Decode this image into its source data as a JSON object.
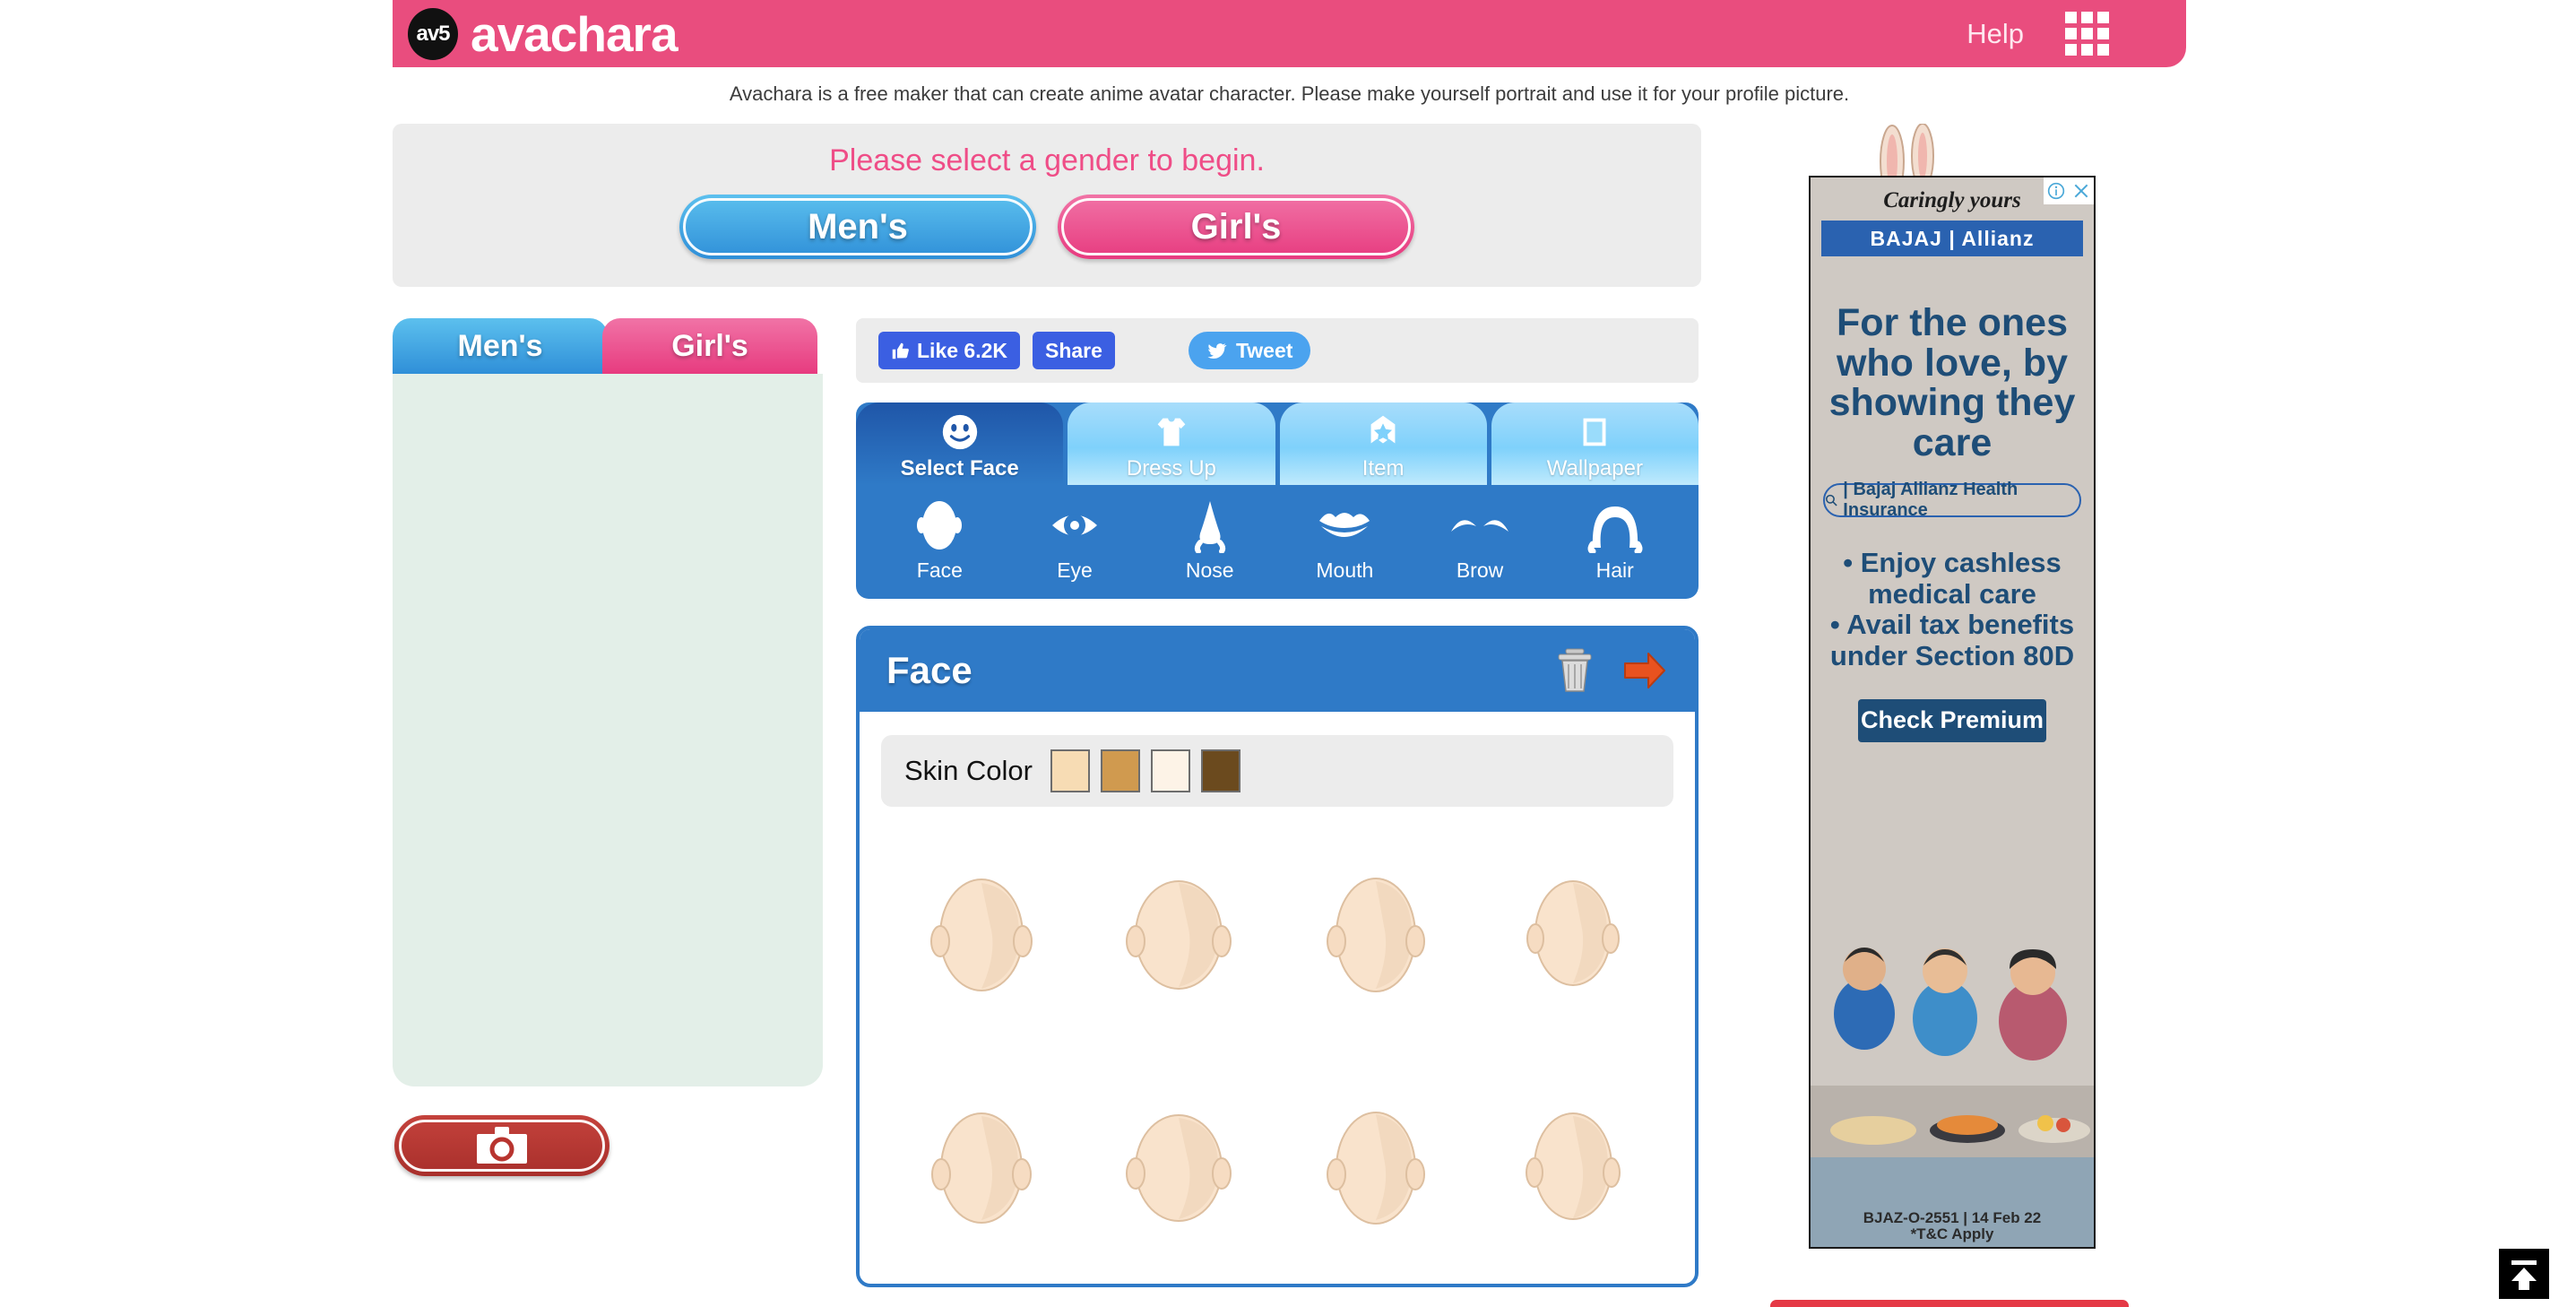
{
  "header": {
    "logo_badge": "av5",
    "logo_text": "avachara",
    "help_label": "Help",
    "grid_icon": "apps-grid-icon",
    "bg_color": "#e94d7e"
  },
  "subtitle": "Avachara is a free maker that can create anime avatar character. Please make yourself portrait and use it for your profile picture.",
  "gender_panel": {
    "title": "Please select a gender to begin.",
    "men_label": "Men's",
    "girl_label": "Girl's",
    "men_color": "#2f8fd8",
    "girl_color": "#e73b7f",
    "mascot": "rabbit-mascot"
  },
  "left_column": {
    "tab_men": "Men's",
    "tab_girl": "Girl's",
    "canvas_color": "#e3efe8",
    "save_icon": "camera-icon",
    "save_color": "#b8342f"
  },
  "social": {
    "like_label": "Like 6.2K",
    "share_label": "Share",
    "tweet_label": "Tweet",
    "thumb_icon": "thumbs-up-icon",
    "twitter_icon": "twitter-bird-icon",
    "facebook_color": "#3b5fe2",
    "twitter_color": "#4ba3ef"
  },
  "category_tabs": [
    {
      "label": "Select Face",
      "icon": "smiley-face-icon",
      "active": true
    },
    {
      "label": "Dress Up",
      "icon": "tshirt-icon",
      "active": false
    },
    {
      "label": "Item",
      "icon": "star-badge-icon",
      "active": false
    },
    {
      "label": "Wallpaper",
      "icon": "picture-frame-icon",
      "active": false
    }
  ],
  "sub_nav": [
    {
      "label": "Face",
      "icon": "face-outline-icon"
    },
    {
      "label": "Eye",
      "icon": "eye-icon"
    },
    {
      "label": "Nose",
      "icon": "nose-icon"
    },
    {
      "label": "Mouth",
      "icon": "mouth-icon"
    },
    {
      "label": "Brow",
      "icon": "eyebrow-icon"
    },
    {
      "label": "Hair",
      "icon": "hair-icon"
    }
  ],
  "panel": {
    "title": "Face",
    "delete_icon": "trash-can-icon",
    "next_icon": "orange-right-arrow-icon",
    "header_color": "#2f7ac7",
    "skin_color_label": "Skin Color",
    "skin_swatches": [
      "#f7dcb4",
      "#d09a4f",
      "#fdf3e7",
      "#6b4a1e"
    ],
    "face_thumbnails": 8
  },
  "ad": {
    "info_icon": "info-icon",
    "close_icon": "close-icon",
    "tagline": "Caringly yours",
    "brand": "BAJAJ | Allianz",
    "headline": "For the ones who love, by showing they care",
    "search_text": "| Bajaj Allianz Health Insurance",
    "bullets": "• Enjoy cashless medical care\n• Avail tax benefits under Section 80D",
    "cta_label": "Check Premium",
    "legal": "BJAZ-O-2551 | 14 Feb 22",
    "legal2": "*T&C Apply",
    "brand_color": "#2a62b0",
    "text_color": "#1e4d77"
  },
  "to_top": {
    "icon": "scroll-to-top-icon"
  }
}
